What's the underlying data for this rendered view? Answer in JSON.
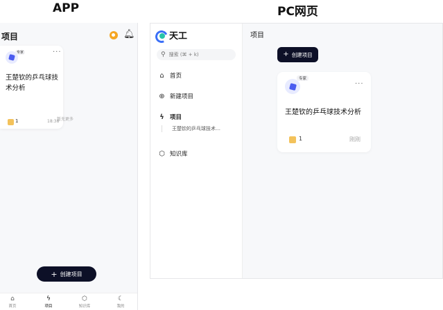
{
  "labels": {
    "app": "APP",
    "pc": "PC网页"
  },
  "app": {
    "header_title": "项目",
    "card": {
      "tag": "专家",
      "more": "···",
      "project_name": "王楚钦的乒乓球技术分析",
      "count": "1",
      "time": "18:38"
    },
    "no_more": "暂无更多",
    "create_button": "创建项目",
    "tabs": [
      {
        "label": "首页",
        "icon": "home-icon"
      },
      {
        "label": "项目",
        "icon": "bolt-icon"
      },
      {
        "label": "知识库",
        "icon": "cube-icon"
      },
      {
        "label": "我的",
        "icon": "user-icon"
      }
    ]
  },
  "pc": {
    "brand": "天工",
    "search_placeholder": "搜索 (⌘ + k)",
    "nav": {
      "home": "首页",
      "new_project": "新建项目",
      "projects": "项目",
      "project_sub": "王楚钦的乒乓球技术…",
      "knowledge": "知识库"
    },
    "main_title": "项目",
    "create_button": "创建项目",
    "card": {
      "tag": "专家",
      "more": "···",
      "project_name": "王楚钦的乒乓球技术分析",
      "count": "1",
      "time": "刚刚"
    }
  },
  "colors": {
    "button_dark": "#0d1027",
    "accent_blue": "#4b5cf0",
    "coin": "#f5a623"
  }
}
